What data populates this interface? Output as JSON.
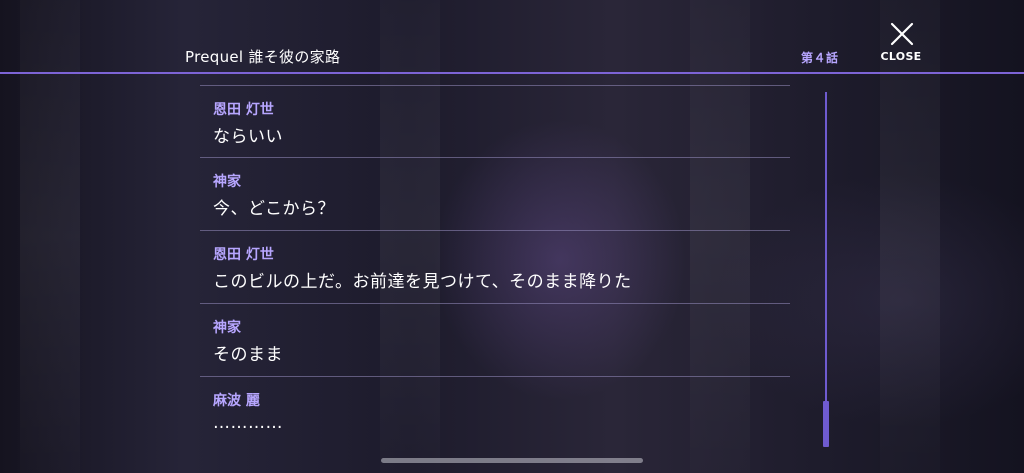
{
  "header": {
    "title": "Prequel 誰そ彼の家路",
    "episode": "第４話",
    "close_label": "CLOSE"
  },
  "log": [
    {
      "speaker": "恩田 灯世",
      "text": "ならいい"
    },
    {
      "speaker": "神家",
      "text": "今、どこから？"
    },
    {
      "speaker": "恩田 灯世",
      "text": "このビルの上だ。お前達を見つけて、そのまま降りた"
    },
    {
      "speaker": "神家",
      "text": "そのまま"
    },
    {
      "speaker": "麻波 麗",
      "text": "…………"
    }
  ],
  "colors": {
    "accent": "#7d64d6",
    "speaker": "#b7a6ff",
    "text": "#ffffff"
  },
  "icons": {
    "close": "close-icon"
  }
}
